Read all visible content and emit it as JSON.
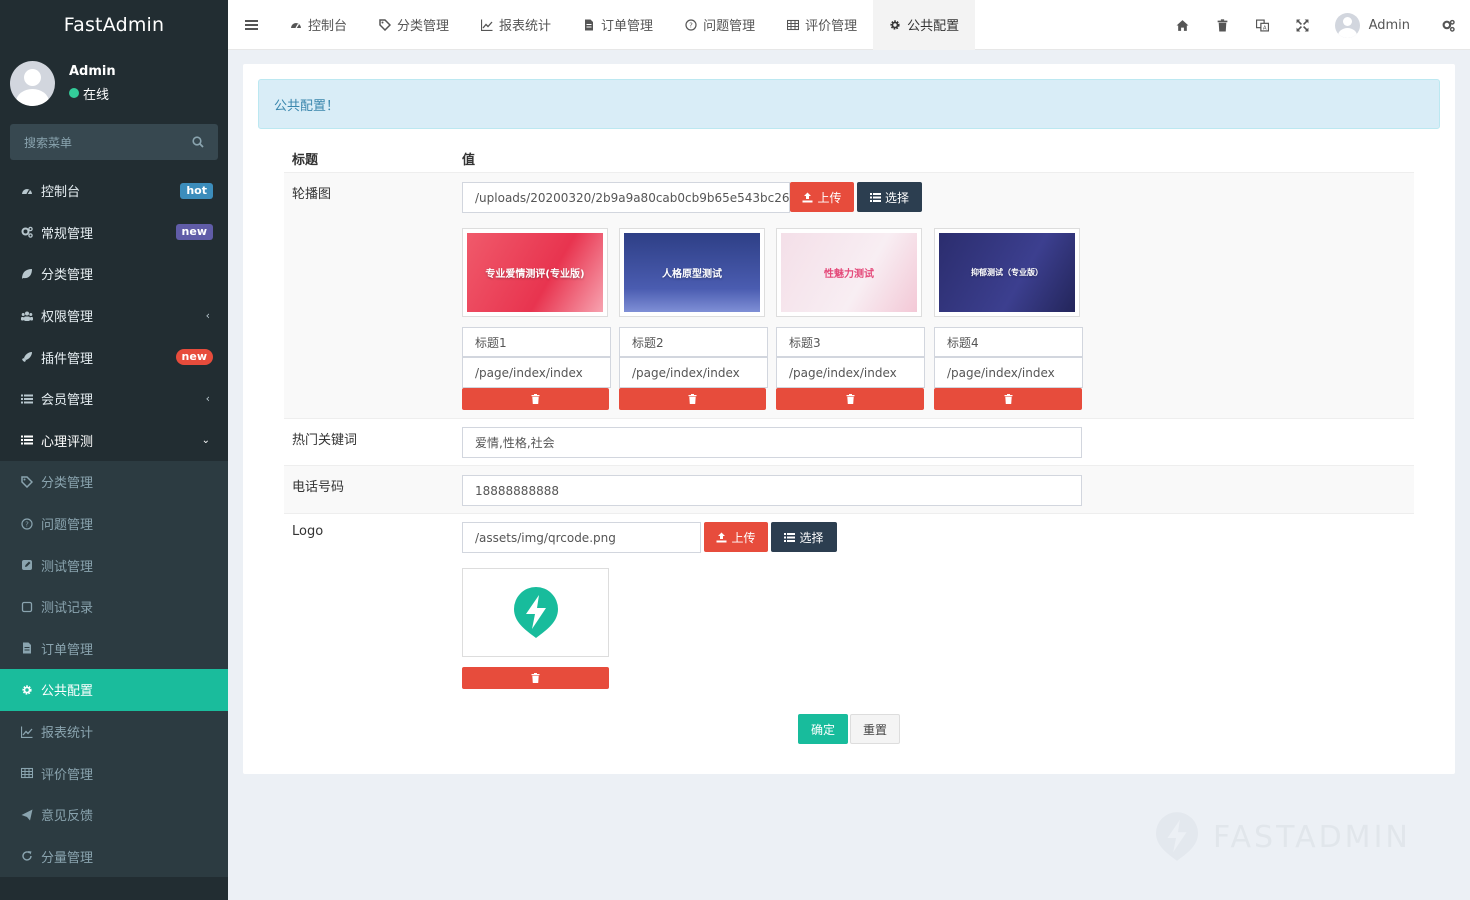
{
  "app": {
    "title": "FastAdmin"
  },
  "user": {
    "name": "Admin",
    "status": "在线"
  },
  "search": {
    "placeholder": "搜索菜单"
  },
  "menu": [
    {
      "label": "控制台",
      "icon": "dashboard-icon",
      "badge": "hot"
    },
    {
      "label": "常规管理",
      "icon": "cogs-icon",
      "badge": "new"
    },
    {
      "label": "分类管理",
      "icon": "leaf-icon"
    },
    {
      "label": "权限管理",
      "icon": "group-icon"
    },
    {
      "label": "插件管理",
      "icon": "rocket-icon",
      "badge": "new"
    },
    {
      "label": "会员管理",
      "icon": "list-icon"
    },
    {
      "label": "心理评测",
      "icon": "list-icon"
    },
    {
      "label": "分类管理",
      "icon": "tag-icon"
    },
    {
      "label": "问题管理",
      "icon": "question-icon"
    },
    {
      "label": "测试管理",
      "icon": "edit-icon"
    },
    {
      "label": "测试记录",
      "icon": "square-icon"
    },
    {
      "label": "订单管理",
      "icon": "file-icon"
    },
    {
      "label": "公共配置",
      "icon": "gear-icon"
    },
    {
      "label": "报表统计",
      "icon": "line-chart-icon"
    },
    {
      "label": "评价管理",
      "icon": "table-icon"
    },
    {
      "label": "意见反馈",
      "icon": "send-icon"
    },
    {
      "label": "分量管理",
      "icon": "refresh-icon"
    }
  ],
  "tabs": [
    {
      "label": "控制台",
      "icon": "dashboard-icon"
    },
    {
      "label": "分类管理",
      "icon": "tag-icon"
    },
    {
      "label": "报表统计",
      "icon": "line-chart-icon"
    },
    {
      "label": "订单管理",
      "icon": "file-icon"
    },
    {
      "label": "问题管理",
      "icon": "question-icon"
    },
    {
      "label": "评价管理",
      "icon": "table-icon"
    },
    {
      "label": "公共配置",
      "icon": "gear-icon"
    }
  ],
  "topbar": {
    "user": "Admin"
  },
  "page": {
    "alert": "公共配置！",
    "col_title": "标题",
    "col_value": "值",
    "carousel": {
      "label": "轮播图",
      "path": "/uploads/20200320/2b9a9a80cab0cb9b65e543bc267c8",
      "upload": "上传",
      "select": "选择",
      "items": [
        {
          "image_text": "专业爱情测评(专业版)",
          "title": "标题1",
          "url": "/page/index/index"
        },
        {
          "image_text": "人格原型测试",
          "title": "标题2",
          "url": "/page/index/index"
        },
        {
          "image_text": "性魅力测试",
          "title": "标题3",
          "url": "/page/index/index"
        },
        {
          "image_text": "抑郁测试（专业版）",
          "title": "标题4",
          "url": "/page/index/index"
        }
      ]
    },
    "keywords": {
      "label": "热门关键词",
      "value": "爱情,性格,社会"
    },
    "phone": {
      "label": "电话号码",
      "value": "18888888888"
    },
    "logo": {
      "label": "Logo",
      "path": "/assets/img/qrcode.png",
      "upload": "上传",
      "select": "选择"
    },
    "submit": "确定",
    "reset": "重置"
  },
  "watermark": "FASTADMIN",
  "colors": {
    "sidebar": "#222d32",
    "active": "#1abc9c",
    "danger": "#e74c3c",
    "dark": "#2c3e50"
  }
}
